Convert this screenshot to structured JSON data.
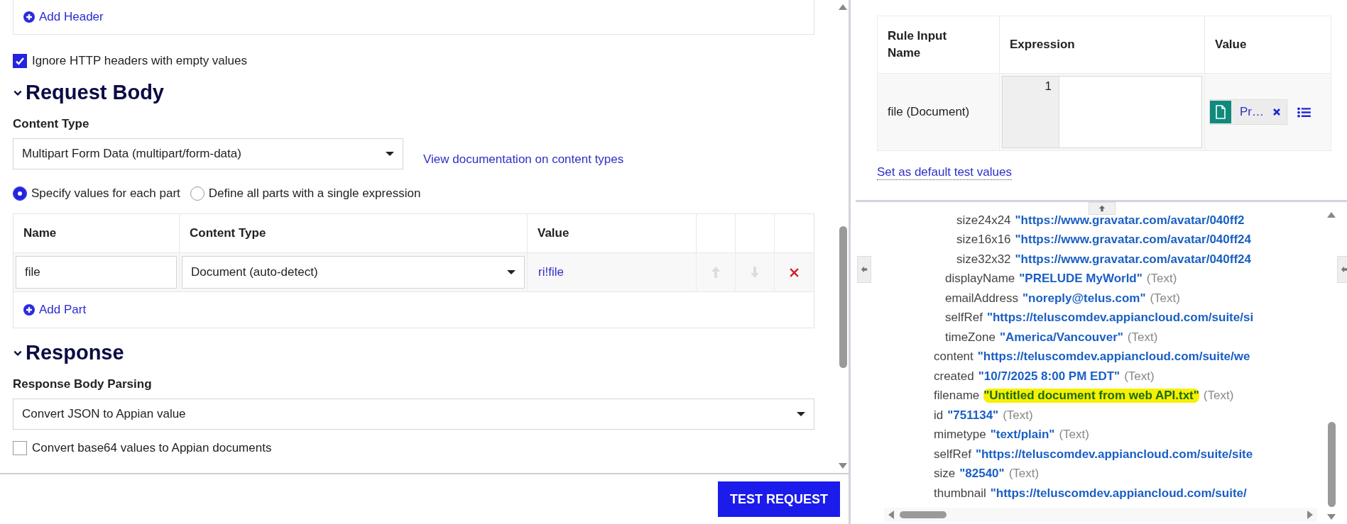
{
  "headers": {
    "add_label": "Add Header"
  },
  "ignore_empty_headers": {
    "label": "Ignore HTTP headers with empty values",
    "checked": true
  },
  "request_body": {
    "title": "Request Body",
    "expanded": true,
    "content_type_label": "Content Type",
    "content_type": "Multipart Form Data (multipart/form-data)",
    "doc_link": "View documentation on content types",
    "modes": [
      {
        "label": "Specify values for each part",
        "selected": true
      },
      {
        "label": "Define all parts with a single expression",
        "selected": false
      }
    ],
    "parts_table": {
      "columns": [
        "Name",
        "Content Type",
        "Value"
      ],
      "rows": [
        {
          "name": "file",
          "content_type": "Document (auto-detect)",
          "value": "ri!file",
          "move_up_disabled": true,
          "move_down_disabled": true
        }
      ]
    },
    "add_part_label": "Add Part"
  },
  "response": {
    "title": "Response",
    "expanded": true,
    "parsing_label": "Response Body Parsing",
    "parsing": "Convert JSON to Appian value",
    "base64": {
      "label": "Convert base64 values to Appian documents",
      "checked": false
    }
  },
  "test_button": "TEST REQUEST",
  "rule_inputs": {
    "columns": [
      "Rule Input Name",
      "Expression",
      "Value"
    ],
    "rows": [
      {
        "name": "file (Document)",
        "line_number": "1",
        "value": "Pr…"
      }
    ],
    "default_link": "Set as default test values"
  },
  "result_tree": [
    {
      "children": [
        {
          "children": [
            {
              "key": "size24x24",
              "value": "\"https://www.gravatar.com/avatar/040ff2"
            },
            {
              "key": "size16x16",
              "value": "\"https://www.gravatar.com/avatar/040ff24"
            },
            {
              "key": "size32x32",
              "value": "\"https://www.gravatar.com/avatar/040ff24"
            }
          ]
        },
        {
          "key": "displayName",
          "value": "\"PRELUDE MyWorld\"",
          "type": "(Text)"
        },
        {
          "key": "emailAddress",
          "value": "\"noreply@telus.com\"",
          "type": "(Text)"
        },
        {
          "key": "selfRef",
          "value": "\"https://teluscomdev.appiancloud.com/suite/si"
        },
        {
          "key": "timeZone",
          "value": "\"America/Vancouver\"",
          "type": "(Text)"
        }
      ]
    },
    {
      "key": "content",
      "value": "\"https://teluscomdev.appiancloud.com/suite/we"
    },
    {
      "key": "created",
      "value": "\"10/7/2025 8:00 PM EDT\"",
      "type": "(Text)"
    },
    {
      "key": "filename",
      "value": "\"Untitled document from web API.txt\"",
      "type": "(Text)",
      "highlighted": true
    },
    {
      "key": "id",
      "value": "\"751134\"",
      "type": "(Text)"
    },
    {
      "key": "mimetype",
      "value": "\"text/plain\"",
      "type": "(Text)"
    },
    {
      "key": "selfRef",
      "value": "\"https://teluscomdev.appiancloud.com/suite/site"
    },
    {
      "key": "size",
      "value": "\"82540\"",
      "type": "(Text)"
    },
    {
      "key": "thumbnail",
      "value": "\"https://teluscomdev.appiancloud.com/suite/"
    }
  ]
}
